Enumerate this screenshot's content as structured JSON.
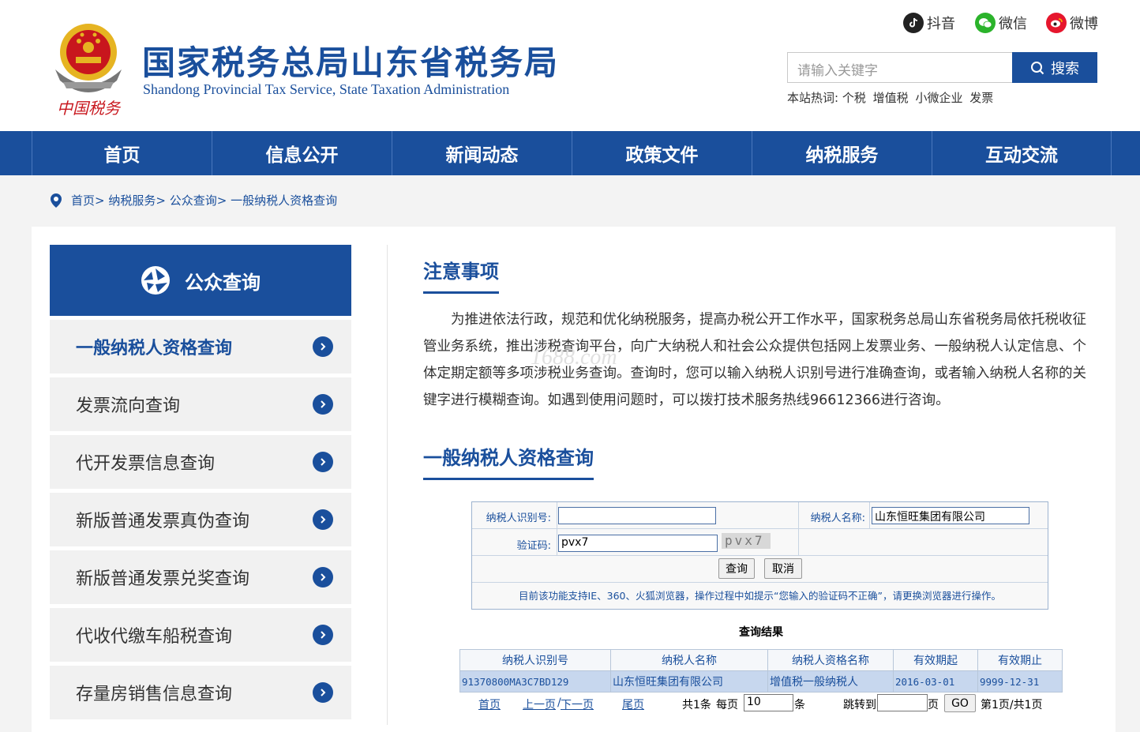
{
  "header": {
    "title_cn": "国家税务总局山东省税务局",
    "title_en": "Shandong Provincial Tax Service, State Taxation Administration",
    "emblem_text": "中国税务",
    "social": [
      {
        "label": "抖音",
        "icon": "douyin-icon",
        "color": "#222222"
      },
      {
        "label": "微信",
        "icon": "wechat-icon",
        "color": "#2bb32b"
      },
      {
        "label": "微博",
        "icon": "weibo-icon",
        "color": "#e6162d"
      }
    ],
    "search": {
      "placeholder": "请输入关键字",
      "button": "搜索"
    },
    "hot": {
      "label": "本站热词:",
      "words": [
        "个税",
        "增值税",
        "小微企业",
        "发票"
      ]
    }
  },
  "nav": [
    "首页",
    "信息公开",
    "新闻动态",
    "政策文件",
    "纳税服务",
    "互动交流"
  ],
  "breadcrumb": [
    "首页>",
    "纳税服务>",
    "公众查询>",
    "一般纳税人资格查询"
  ],
  "sidebar": {
    "title": "公众查询",
    "items": [
      {
        "label": "一般纳税人资格查询",
        "active": true
      },
      {
        "label": "发票流向查询",
        "active": false
      },
      {
        "label": "代开发票信息查询",
        "active": false
      },
      {
        "label": "新版普通发票真伪查询",
        "active": false
      },
      {
        "label": "新版普通发票兑奖查询",
        "active": false
      },
      {
        "label": "代收代缴车船税查询",
        "active": false
      },
      {
        "label": "存量房销售信息查询",
        "active": false
      }
    ]
  },
  "main": {
    "notice_title": "注意事项",
    "notice_text": "为推进依法行政，规范和优化纳税服务，提高办税公开工作水平，国家税务总局山东省税务局依托税收征管业务系统，推出涉税查询平台，向广大纳税人和社会公众提供包括网上发票业务、一般纳税人认定信息、个体定期定额等多项涉税业务查询。查询时，您可以输入纳税人识别号进行准确查询，或者输入纳税人名称的关键字进行模糊查询。如遇到使用问题时，可以拨打技术服务热线96612366进行咨询。",
    "watermark": "1688.com",
    "query_title": "一般纳税人资格查询",
    "form": {
      "id_label": "纳税人识别号:",
      "id_value": "",
      "name_label": "纳税人名称:",
      "name_value": "山东恒旺集团有限公司",
      "captcha_label": "验证码:",
      "captcha_value": "pvx7",
      "captcha_image_text": "pvx7",
      "query_button": "查询",
      "cancel_button": "取消",
      "note": "目前该功能支持IE、360、火狐浏览器，操作过程中如提示“您输入的验证码不正确”，请更换浏览器进行操作。"
    },
    "result": {
      "title": "查询结果",
      "columns": [
        "纳税人识别号",
        "纳税人名称",
        "纳税人资格名称",
        "有效期起",
        "有效期止"
      ],
      "rows": [
        [
          "91370800MA3C7BD129",
          "山东恒旺集团有限公司",
          "增值税一般纳税人",
          "2016-03-01",
          "9999-12-31"
        ]
      ]
    },
    "pager": {
      "first": "首页",
      "prev": "上一页",
      "sep": "/",
      "next": "下一页",
      "last": "尾页",
      "total": "共1条",
      "per_page_label": "每页",
      "per_page_value": "10",
      "per_page_unit": "条",
      "jump_label": "跳转到",
      "jump_value": "",
      "jump_unit": "页",
      "go": "GO",
      "page_info": "第1页/共1页"
    }
  },
  "colors": {
    "brand_blue": "#1a4f9c",
    "emblem_red": "#c8161d",
    "emblem_gold": "#e6b422"
  }
}
